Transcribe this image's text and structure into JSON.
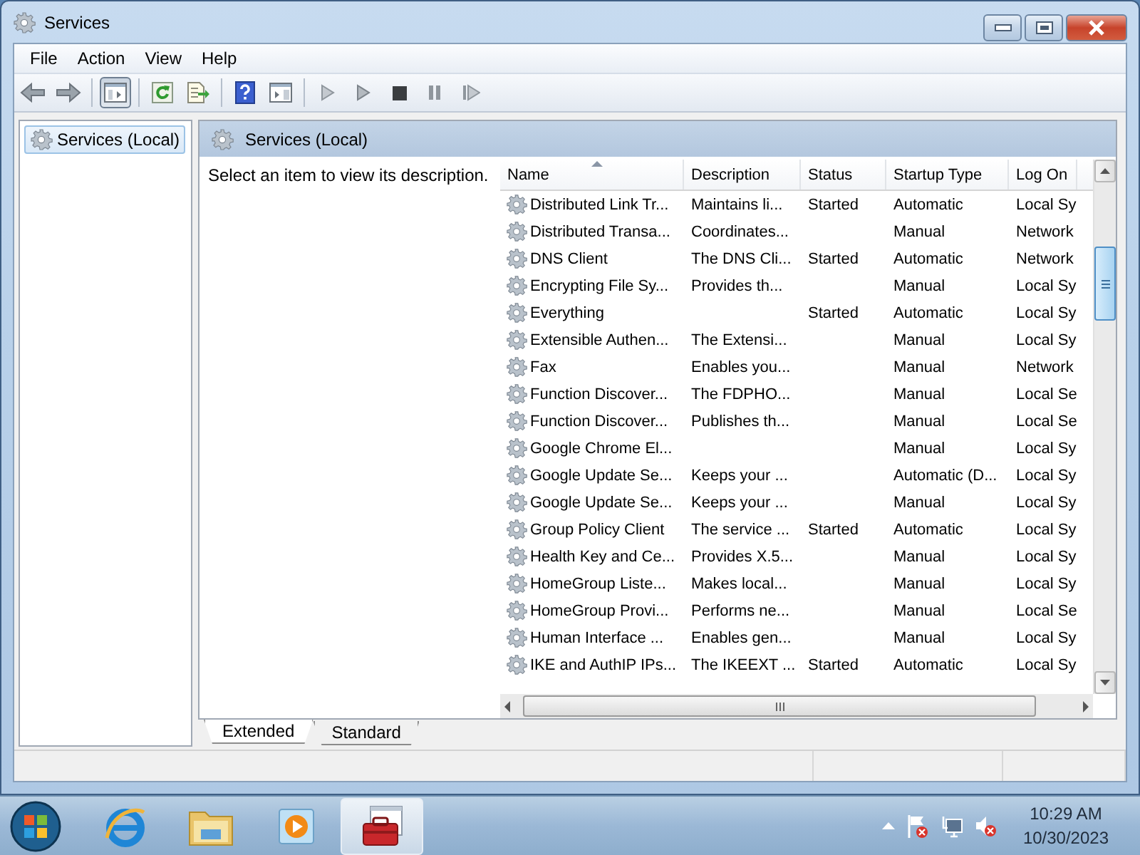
{
  "window": {
    "title": "Services"
  },
  "menu": [
    "File",
    "Action",
    "View",
    "Help"
  ],
  "toolbar": [
    {
      "kind": "back",
      "pressed": false
    },
    {
      "kind": "forward",
      "pressed": false
    },
    {
      "kind": "separator"
    },
    {
      "kind": "console-tree",
      "pressed": true
    },
    {
      "kind": "separator"
    },
    {
      "kind": "refresh",
      "pressed": false
    },
    {
      "kind": "export",
      "pressed": false
    },
    {
      "kind": "separator"
    },
    {
      "kind": "help",
      "pressed": false
    },
    {
      "kind": "properties",
      "pressed": false
    },
    {
      "kind": "separator"
    },
    {
      "kind": "start-faint",
      "pressed": false
    },
    {
      "kind": "start",
      "pressed": false
    },
    {
      "kind": "stop",
      "pressed": false
    },
    {
      "kind": "pause",
      "pressed": false
    },
    {
      "kind": "resume",
      "pressed": false
    }
  ],
  "sidebar": {
    "items": [
      {
        "label": "Services (Local)",
        "selected": true
      }
    ]
  },
  "panel": {
    "title": "Services (Local)",
    "hint": "Select an item to view its description.",
    "columns": [
      {
        "label": "Name",
        "sorted": true
      },
      {
        "label": "Description",
        "sorted": false
      },
      {
        "label": "Status",
        "sorted": false
      },
      {
        "label": "Startup Type",
        "sorted": false
      },
      {
        "label": "Log On",
        "sorted": false
      }
    ],
    "rows": [
      {
        "name": "Distributed Link Tr...",
        "description": "Maintains li...",
        "status": "Started",
        "startup_type": "Automatic",
        "log_on": "Local Sy"
      },
      {
        "name": "Distributed Transa...",
        "description": "Coordinates...",
        "startup_type": "Manual",
        "log_on": "Network"
      },
      {
        "name": "DNS Client",
        "description": "The DNS Cli...",
        "status": "Started",
        "startup_type": "Automatic",
        "log_on": "Network"
      },
      {
        "name": "Encrypting File Sy...",
        "description": "Provides th...",
        "startup_type": "Manual",
        "log_on": "Local Sy"
      },
      {
        "name": "Everything",
        "status": "Started",
        "startup_type": "Automatic",
        "log_on": "Local Sy"
      },
      {
        "name": "Extensible Authen...",
        "description": "The Extensi...",
        "startup_type": "Manual",
        "log_on": "Local Sy"
      },
      {
        "name": "Fax",
        "description": "Enables you...",
        "startup_type": "Manual",
        "log_on": "Network"
      },
      {
        "name": "Function Discover...",
        "description": "The FDPHO...",
        "startup_type": "Manual",
        "log_on": "Local Se"
      },
      {
        "name": "Function Discover...",
        "description": "Publishes th...",
        "startup_type": "Manual",
        "log_on": "Local Se"
      },
      {
        "name": "Google Chrome El...",
        "startup_type": "Manual",
        "log_on": "Local Sy"
      },
      {
        "name": "Google Update Se...",
        "description": "Keeps your ...",
        "startup_type": "Automatic (D...",
        "log_on": "Local Sy"
      },
      {
        "name": "Google Update Se...",
        "description": "Keeps your ...",
        "startup_type": "Manual",
        "log_on": "Local Sy"
      },
      {
        "name": "Group Policy Client",
        "description": "The service ...",
        "status": "Started",
        "startup_type": "Automatic",
        "log_on": "Local Sy"
      },
      {
        "name": "Health Key and Ce...",
        "description": "Provides X.5...",
        "startup_type": "Manual",
        "log_on": "Local Sy"
      },
      {
        "name": "HomeGroup Liste...",
        "description": "Makes local...",
        "startup_type": "Manual",
        "log_on": "Local Sy"
      },
      {
        "name": "HomeGroup Provi...",
        "description": "Performs ne...",
        "startup_type": "Manual",
        "log_on": "Local Se"
      },
      {
        "name": "Human Interface ...",
        "description": "Enables gen...",
        "startup_type": "Manual",
        "log_on": "Local Sy"
      },
      {
        "name": "IKE and AuthIP IPs...",
        "description": "The IKEEXT ...",
        "status": "Started",
        "startup_type": "Automatic",
        "log_on": "Local Sy"
      }
    ],
    "tabs": [
      {
        "label": "Extended",
        "selected": true
      },
      {
        "label": "Standard",
        "selected": false
      }
    ]
  },
  "taskbar": {
    "apps": [
      {
        "kind": "browser",
        "active": false
      },
      {
        "kind": "folder",
        "active": false
      },
      {
        "kind": "media",
        "active": false
      },
      {
        "kind": "services",
        "active": true
      }
    ],
    "clock": {
      "time": "10:29 AM",
      "date": "10/30/2023"
    }
  }
}
